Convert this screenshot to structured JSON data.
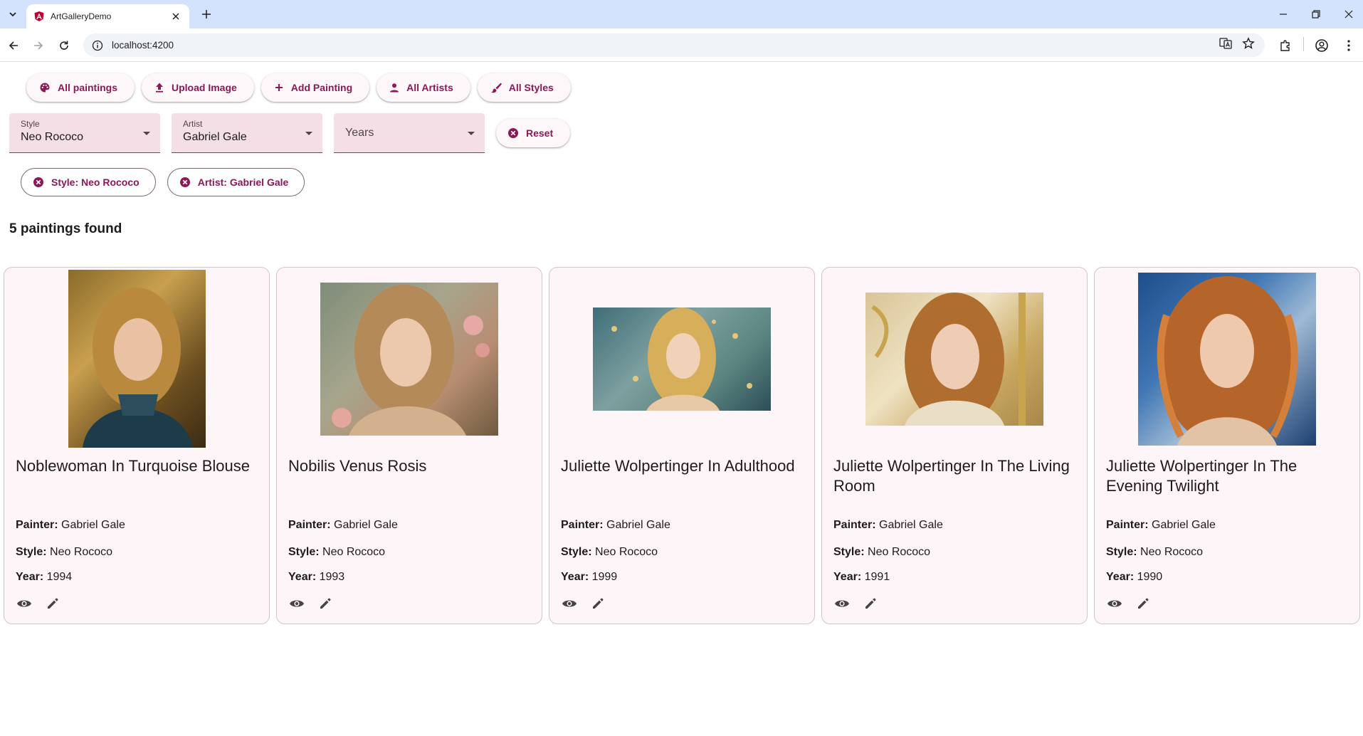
{
  "browser": {
    "tab_title": "ArtGalleryDemo",
    "url": "localhost:4200"
  },
  "nav": {
    "all_paintings": "All paintings",
    "upload_image": "Upload Image",
    "add_painting": "Add Painting",
    "all_artists": "All Artists",
    "all_styles": "All Styles"
  },
  "filters": {
    "style": {
      "label": "Style",
      "value": "Neo Rococo"
    },
    "artist": {
      "label": "Artist",
      "value": "Gabriel Gale"
    },
    "years": {
      "placeholder": "Years"
    },
    "reset_label": "Reset"
  },
  "chips": [
    {
      "label": "Style: Neo Rococo"
    },
    {
      "label": "Artist: Gabriel Gale"
    }
  ],
  "results_count": "5 paintings found",
  "labels": {
    "painter": "Painter:",
    "style": "Style:",
    "year": "Year:"
  },
  "paintings": [
    {
      "title": "Noblewoman In Turquoise Blouse",
      "painter": "Gabriel Gale",
      "style": "Neo Rococo",
      "year": "1994"
    },
    {
      "title": "Nobilis Venus Rosis",
      "painter": "Gabriel Gale",
      "style": "Neo Rococo",
      "year": "1993"
    },
    {
      "title": "Juliette Wolpertinger In Adulthood",
      "painter": "Gabriel Gale",
      "style": "Neo Rococo",
      "year": "1999"
    },
    {
      "title": "Juliette Wolpertinger In The Living Room",
      "painter": "Gabriel Gale",
      "style": "Neo Rococo",
      "year": "1991"
    },
    {
      "title": "Juliette Wolpertinger In The Evening Twilight",
      "painter": "Gabriel Gale",
      "style": "Neo Rococo",
      "year": "1990"
    }
  ],
  "colors": {
    "accent": "#8b1857",
    "chrome_tabbar": "#d3e3fd",
    "select_fill": "#f5dfe6",
    "card_bg": "#fdf5f7"
  }
}
